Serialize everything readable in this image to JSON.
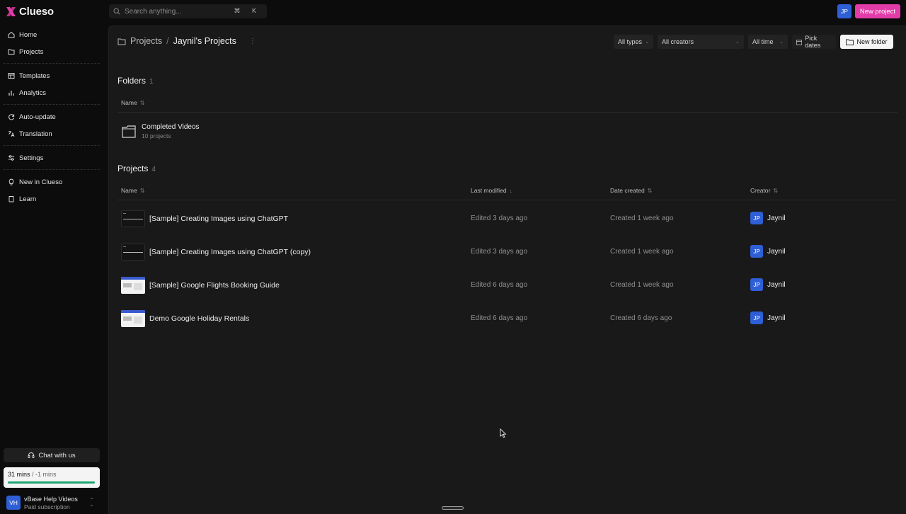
{
  "app": {
    "name": "Clueso",
    "brand_color": "#e23ca8"
  },
  "search": {
    "placeholder": "Search anything...",
    "shortcut": "⌘ K"
  },
  "user": {
    "initials": "JP"
  },
  "header": {
    "new_project_label": "New project"
  },
  "sidebar": {
    "groups": [
      [
        {
          "label": "Home",
          "icon": "home-icon"
        },
        {
          "label": "Projects",
          "icon": "folder-icon"
        }
      ],
      [
        {
          "label": "Templates",
          "icon": "template-icon"
        },
        {
          "label": "Analytics",
          "icon": "chart-icon"
        }
      ],
      [
        {
          "label": "Auto-update",
          "icon": "refresh-icon"
        },
        {
          "label": "Translation",
          "icon": "translate-icon"
        }
      ],
      [
        {
          "label": "Settings",
          "icon": "sliders-icon"
        }
      ],
      [
        {
          "label": "New in Clueso",
          "icon": "bulb-icon"
        },
        {
          "label": "Learn",
          "icon": "book-icon"
        }
      ]
    ],
    "chat_label": "Chat with us",
    "usage": {
      "used": "31 mins",
      "remaining": "/ -1 mins",
      "progress": 1.0
    },
    "account": {
      "initials": "VH",
      "name": "vBase Help Videos",
      "plan": "Paid subscription"
    }
  },
  "breadcrumb": {
    "root": "Projects",
    "separator": "/",
    "current": "Jaynil's Projects"
  },
  "filters": {
    "types": "All types",
    "creators": "All creators",
    "time": "All time",
    "dates": "Pick dates",
    "new_folder": "New folder"
  },
  "folders": {
    "title": "Folders",
    "count": "1",
    "columns": {
      "name": "Name"
    },
    "items": [
      {
        "name": "Completed Videos",
        "sub": "10 projects"
      }
    ]
  },
  "projects": {
    "title": "Projects",
    "count": "4",
    "columns": {
      "name": "Name",
      "modified": "Last modified",
      "created": "Date created",
      "creator": "Creator"
    },
    "rows": [
      {
        "name": "[Sample] Creating Images using ChatGPT",
        "modified": "Edited 3 days ago",
        "created": "Created 1 week ago",
        "creator": "Jaynil",
        "creator_initials": "JP",
        "thumb": "dark"
      },
      {
        "name": "[Sample] Creating Images using ChatGPT (copy)",
        "modified": "Edited 3 days ago",
        "created": "Created 1 week ago",
        "creator": "Jaynil",
        "creator_initials": "JP",
        "thumb": "dark"
      },
      {
        "name": "[Sample] Google Flights Booking Guide",
        "modified": "Edited 6 days ago",
        "created": "Created 1 week ago",
        "creator": "Jaynil",
        "creator_initials": "JP",
        "thumb": "light"
      },
      {
        "name": "Demo Google Holiday Rentals",
        "modified": "Edited 6 days ago",
        "created": "Created 6 days ago",
        "creator": "Jaynil",
        "creator_initials": "JP",
        "thumb": "light"
      }
    ]
  }
}
